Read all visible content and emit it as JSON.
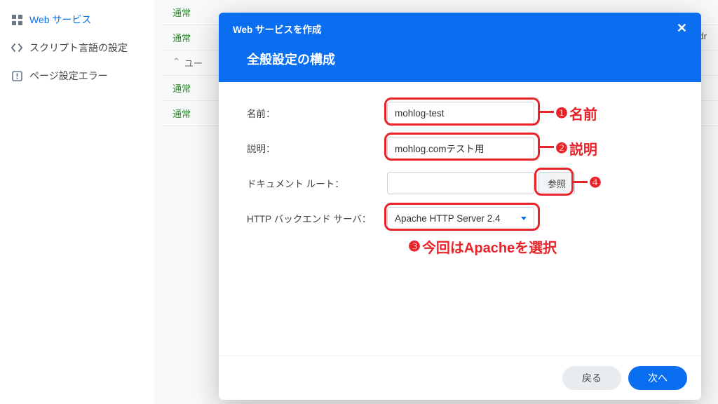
{
  "sidebar": {
    "items": [
      {
        "label": "Web サービス",
        "icon": "grid"
      },
      {
        "label": "スクリプト言語の設定",
        "icon": "code"
      },
      {
        "label": "ページ設定エラー",
        "icon": "warning"
      }
    ]
  },
  "bg_list": {
    "status_label": "通常",
    "expand_label": "ユー",
    "user_right": "adr"
  },
  "modal": {
    "title": "Web サービスを作成",
    "subtitle": "全般設定の構成",
    "fields": {
      "name_label": "名前：",
      "name_value": "mohlog-test",
      "desc_label": "説明：",
      "desc_value": "mohlog.comテスト用",
      "docroot_label": "ドキュメント ルート：",
      "docroot_value": "",
      "browse_label": "参照",
      "backend_label": "HTTP バックエンド サーバ：",
      "backend_value": "Apache HTTP Server 2.4"
    },
    "footer": {
      "back": "戻る",
      "next": "次へ"
    }
  },
  "annotations": {
    "a1": "名前",
    "a2": "説明",
    "a3": "今回はApacheを選択",
    "n1": "❶",
    "n2": "❷",
    "n3": "❸",
    "n4": "❹"
  }
}
